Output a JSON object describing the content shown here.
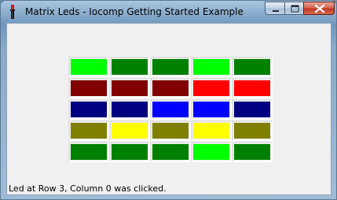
{
  "window": {
    "title": "Matrix Leds - Iocomp Getting Started Example",
    "icon": "paintbrush-icon"
  },
  "title_buttons": [
    "minimize-icon",
    "maximize-icon",
    "close-icon"
  ],
  "matrix": {
    "rows": 5,
    "columns": 5,
    "colors": [
      [
        "#00ff00",
        "#008000",
        "#008000",
        "#00ff00",
        "#008000"
      ],
      [
        "#800000",
        "#800000",
        "#800000",
        "#ff0000",
        "#ff0000"
      ],
      [
        "#000080",
        "#000080",
        "#0000ff",
        "#0000ff",
        "#000080"
      ],
      [
        "#808000",
        "#ffff00",
        "#808000",
        "#ffff00",
        "#808000"
      ],
      [
        "#008000",
        "#008000",
        "#008000",
        "#00ff00",
        "#008000"
      ]
    ]
  },
  "status": {
    "text": "Led at Row 3, Column 0 was clicked."
  }
}
